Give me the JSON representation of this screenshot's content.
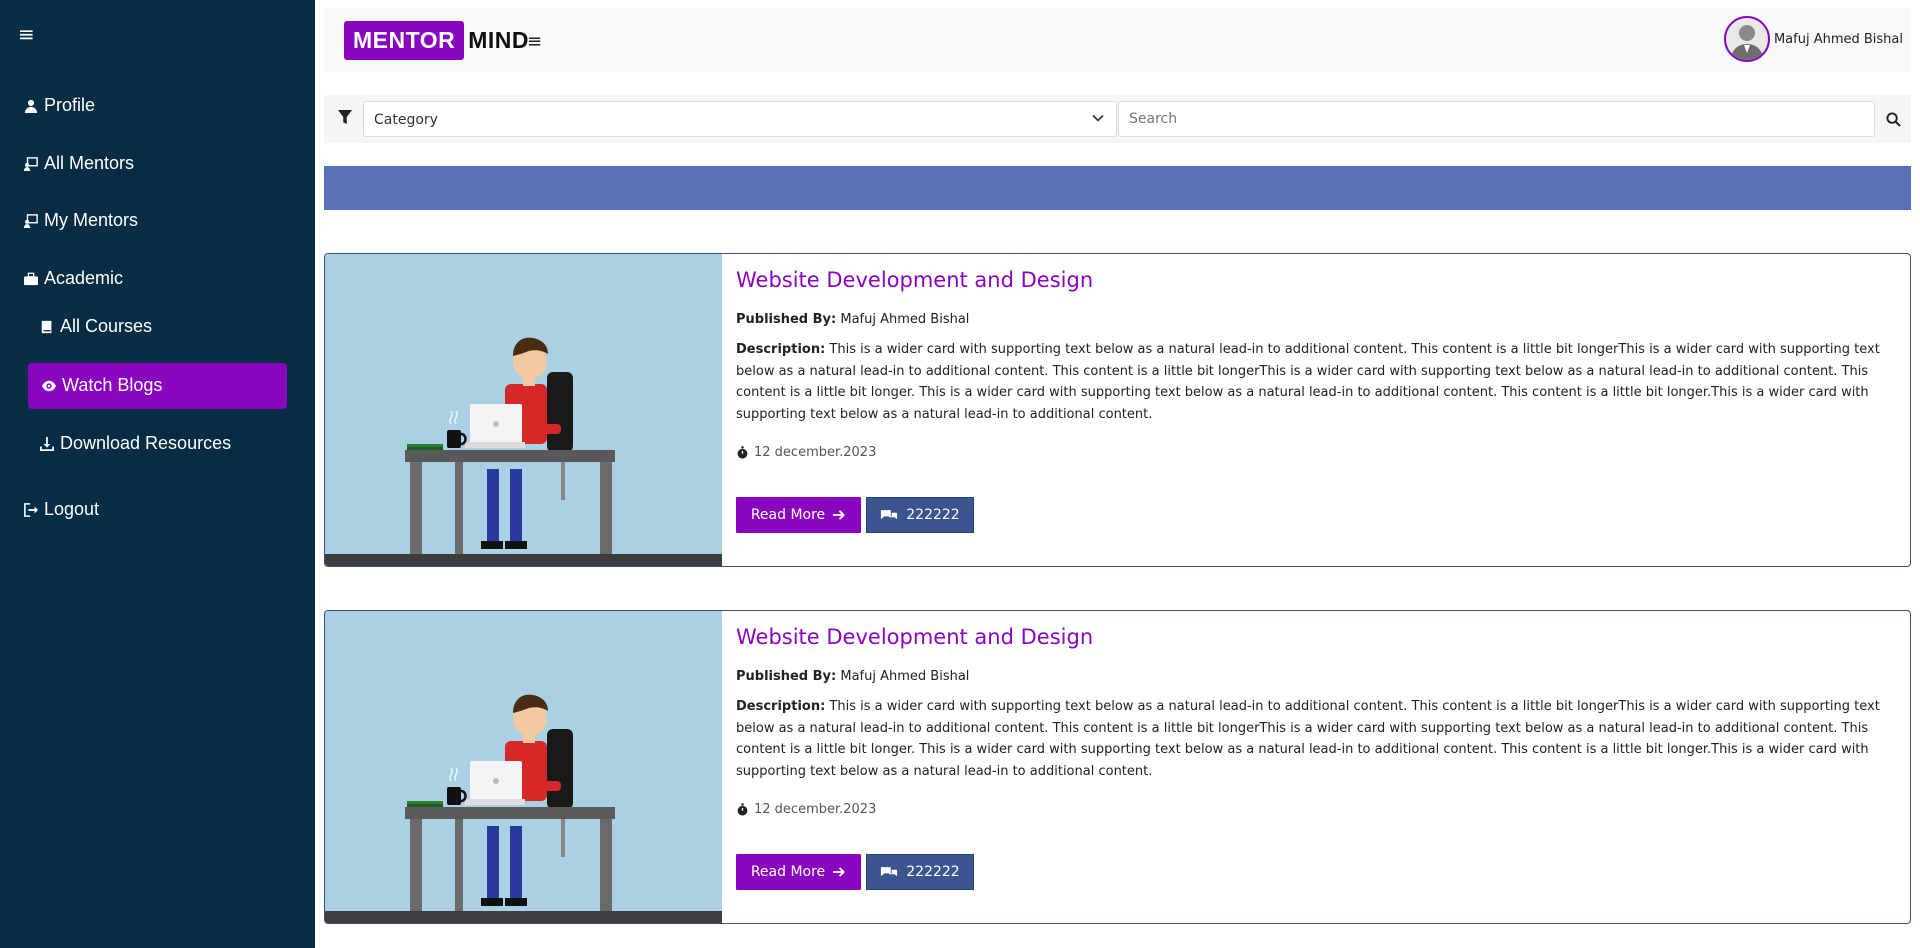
{
  "brand": {
    "part1": "MENTOR",
    "part2": "MIND"
  },
  "user": {
    "name": "Mafuj Ahmed Bishal"
  },
  "sidebar": {
    "items": [
      {
        "label": "Profile",
        "icon": "user-icon"
      },
      {
        "label": "All Mentors",
        "icon": "chalkboard-icon"
      },
      {
        "label": "My Mentors",
        "icon": "chalkboard-icon"
      },
      {
        "label": "Academic",
        "icon": "briefcase-icon"
      },
      {
        "label": "All Courses",
        "icon": "book-icon"
      },
      {
        "label": "Watch Blogs",
        "icon": "eye-icon",
        "active": true
      },
      {
        "label": "Download Resources",
        "icon": "download-icon"
      },
      {
        "label": "Logout",
        "icon": "logout-icon"
      }
    ]
  },
  "filters": {
    "category_value": "Category",
    "search_placeholder": "Search"
  },
  "blogs": [
    {
      "title": "Website Development and Design",
      "published_label": "Published By:",
      "author": "Mafuj Ahmed Bishal",
      "description_label": "Description:",
      "description": "This is a wider card with supporting text below as a natural lead-in to additional content. This content is a little bit longerThis is a wider card with supporting text below as a natural lead-in to additional content. This content is a little bit longerThis is a wider card with supporting text below as a natural lead-in to additional content. This content is a little bit longer. This is a wider card with supporting text below as a natural lead-in to additional content. This content is a little bit longer.This is a wider card with supporting text below as a natural lead-in to additional content.",
      "date": "12 december.2023",
      "read_more": "Read More",
      "comments": "222222"
    },
    {
      "title": "Website Development and Design",
      "published_label": "Published By:",
      "author": "Mafuj Ahmed Bishal",
      "description_label": "Description:",
      "description": "This is a wider card with supporting text below as a natural lead-in to additional content. This content is a little bit longerThis is a wider card with supporting text below as a natural lead-in to additional content. This content is a little bit longerThis is a wider card with supporting text below as a natural lead-in to additional content. This content is a little bit longer. This is a wider card with supporting text below as a natural lead-in to additional content. This content is a little bit longer.This is a wider card with supporting text below as a natural lead-in to additional content.",
      "date": "12 december.2023",
      "read_more": "Read More",
      "comments": "222222"
    }
  ],
  "colors": {
    "sidebar_bg": "#072d44",
    "accent": "#8a05be",
    "banner": "#5870b4",
    "comment_btn": "#3b5591"
  }
}
